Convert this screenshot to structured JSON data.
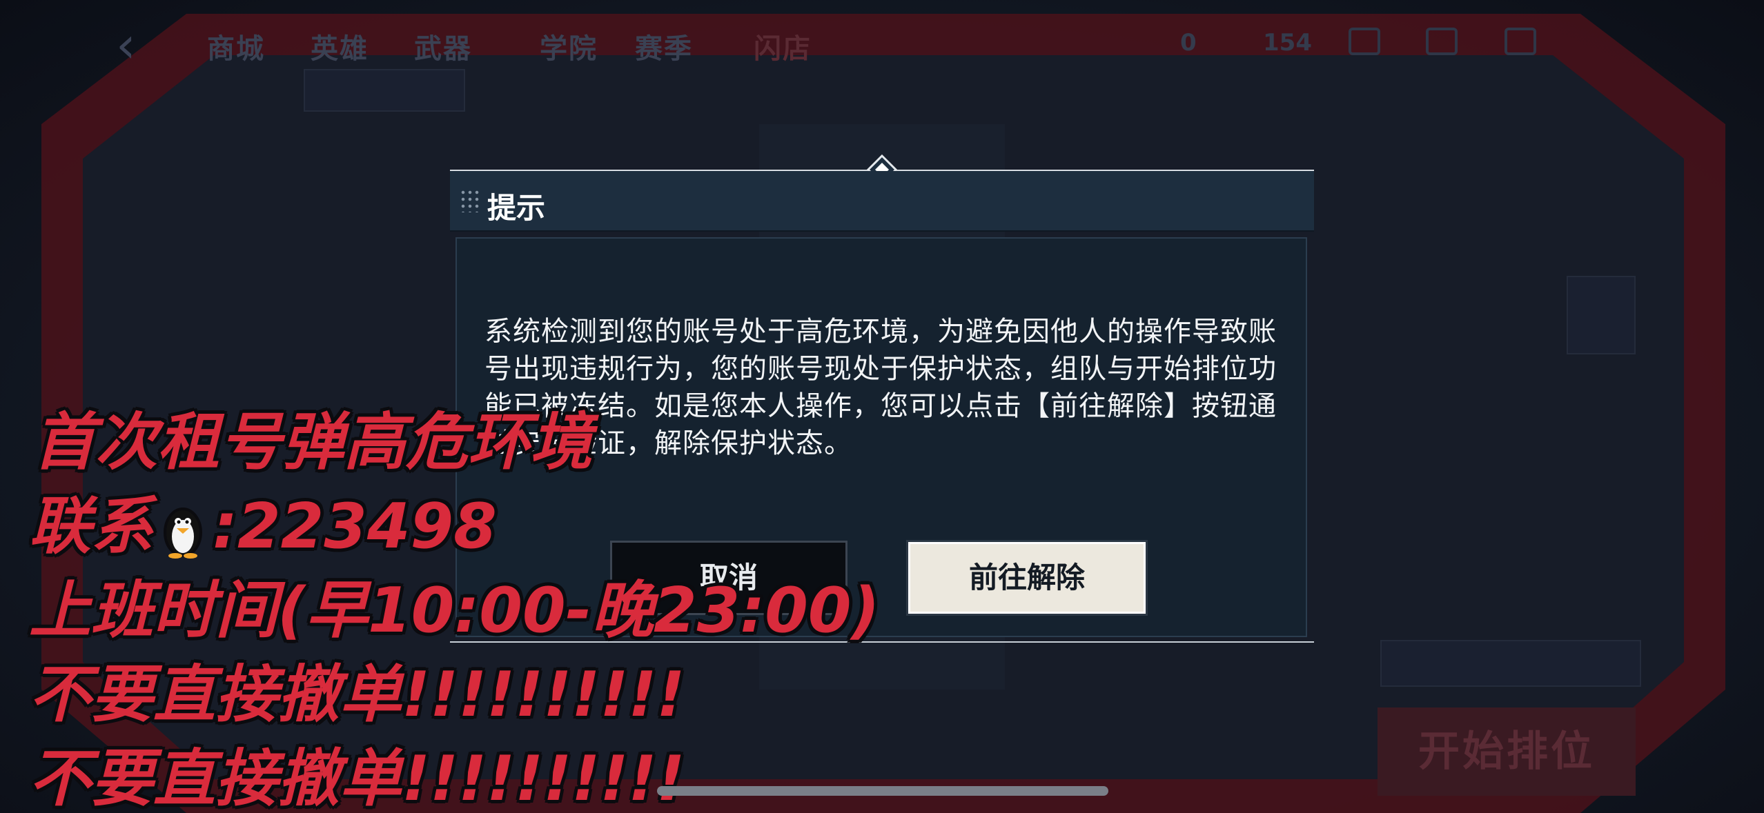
{
  "nav": {
    "tabs": [
      "商城",
      "英雄",
      "武器",
      "学院",
      "赛季",
      "闪店"
    ],
    "stats": [
      "0",
      "154"
    ]
  },
  "dialog": {
    "title": "提示",
    "message": "系统检测到您的账号处于高危环境，为避免因他人的操作导致账号出现违规行为，您的账号现处于保护状态，组队与开始排位功能已被冻结。如是您本人操作，您可以点击【前往解除】按钮通过安全验证，解除保护状态。",
    "cancel_label": "取消",
    "confirm_label": "前往解除"
  },
  "background": {
    "start_button_label": "开始排位"
  },
  "overlay": {
    "line1": "首次租号弹高危环境",
    "line2_prefix": "联系",
    "line2_icon": "penguin-icon",
    "line2_suffix": ":223498",
    "line3": "上班时间(早10:00-晚23:00)",
    "line4": "不要直接撤单!!!!!!!!!!",
    "line5": "不要直接撤单!!!!!!!!!!"
  },
  "colors": {
    "overlay_red": "#d92b3c",
    "backdrop_red": "#6b1822",
    "dialog_header": "#1d2e3f",
    "dialog_body": "#15222f",
    "confirm_button": "#ece8de"
  }
}
